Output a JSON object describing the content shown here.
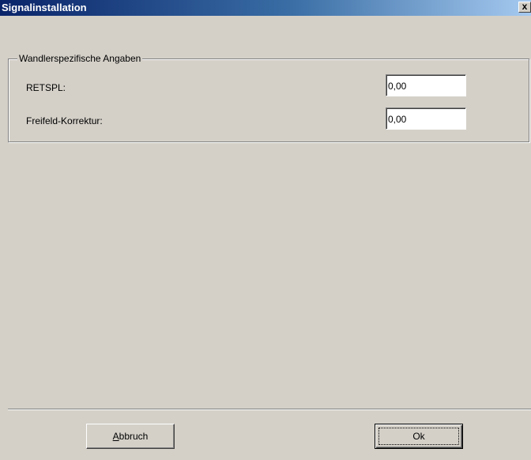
{
  "window": {
    "title": "Signalinstallation",
    "close_symbol": "x"
  },
  "group": {
    "label": "Wandlerspezifische Angaben",
    "fields": [
      {
        "label": "RETSPL:",
        "value": "0,00"
      },
      {
        "label": "Freifeld-Korrektur:",
        "value": "0,00"
      }
    ]
  },
  "buttons": {
    "cancel": {
      "mnemonic": "A",
      "rest": "bbruch"
    },
    "ok": "Ok"
  },
  "colors": {
    "titlebar_start": "#0a246a",
    "titlebar_end": "#a6caf0",
    "face": "#d4d0c8"
  }
}
